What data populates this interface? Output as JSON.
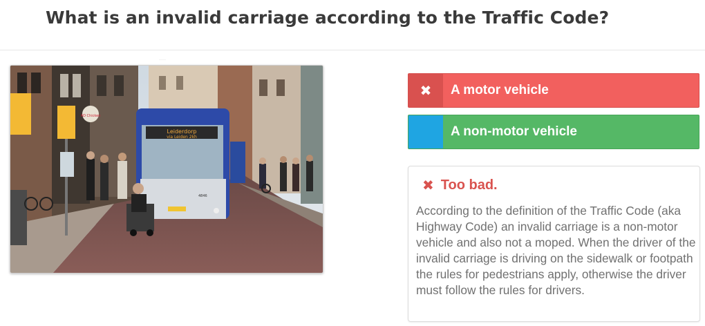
{
  "question": {
    "title": "What is an invalid carriage according to the Traffic Code?"
  },
  "photo": {
    "tiny_caption": "·····",
    "bus_sign": "Leiderdorp",
    "bus_sign_line2": "via Leiden 2kh",
    "bus_number": "4846",
    "store_sign": "AD Chicken"
  },
  "answers": [
    {
      "label": "A motor vehicle",
      "marker_icon": "close-icon",
      "marker": "✖",
      "color": "#f2605e",
      "state": "wrong"
    },
    {
      "label": "A non-motor vehicle",
      "marker_icon": "",
      "marker": "",
      "color": "#55b866",
      "state": "correct"
    }
  ],
  "feedback": {
    "icon": "close-icon",
    "icon_glyph": "✖",
    "heading": "Too bad.",
    "text": "According to the definition of the Traffic Code (aka Highway Code) an invalid carriage is a non-motor vehicle and also not a moped. When the driver of the invalid carriage is driving on the sidewalk or footpath the rules for pedestrians apply, otherwise the driver must follow the rules for drivers."
  }
}
